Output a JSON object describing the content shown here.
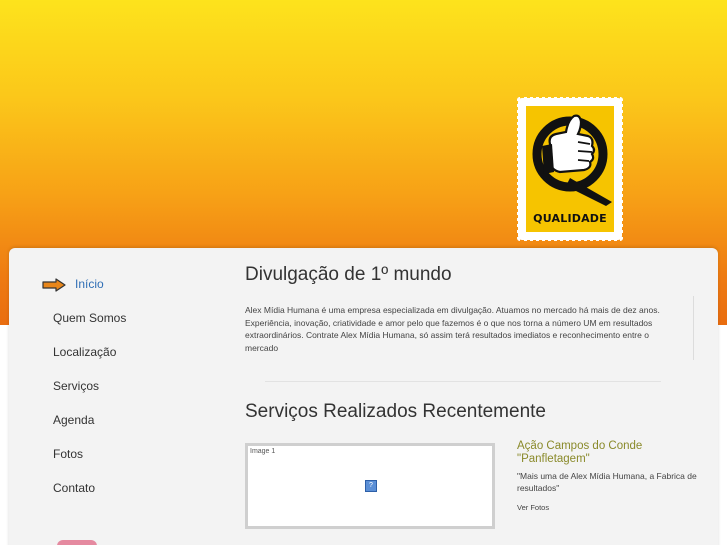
{
  "stamp": {
    "label": "QUALIDADE"
  },
  "nav": {
    "items": [
      {
        "label": "Início",
        "active": true
      },
      {
        "label": "Quem Somos",
        "active": false
      },
      {
        "label": "Localização",
        "active": false
      },
      {
        "label": "Serviços",
        "active": false
      },
      {
        "label": "Agenda",
        "active": false
      },
      {
        "label": "Fotos",
        "active": false
      },
      {
        "label": "Contato",
        "active": false
      }
    ]
  },
  "main": {
    "title": "Divulgação de 1º mundo",
    "intro": "Alex Mídia Humana é uma empresa especializada em divulgação. Atuamos no mercado há mais de dez anos. Experiência, inovação, criatividade e amor pelo que fazemos é o que nos torna a número UM em resultados extraordinários. Contrate Alex Mídia Humana, só assim terá resultados imediatos e reconhecimento entre o mercado",
    "services_title": "Serviços Realizados Recentemente",
    "thumb_label": "Image 1",
    "post": {
      "title": "Ação Campos do Conde \"Panfletagem\"",
      "description": "\"Mais uma de Alex Mídia Humana, a Fabrica de resultados\"",
      "link": "Ver Fotos"
    }
  },
  "colors": {
    "accent_link": "#2f6eb5",
    "post_title": "#8a8a2a",
    "arrow": "#e8861a"
  }
}
